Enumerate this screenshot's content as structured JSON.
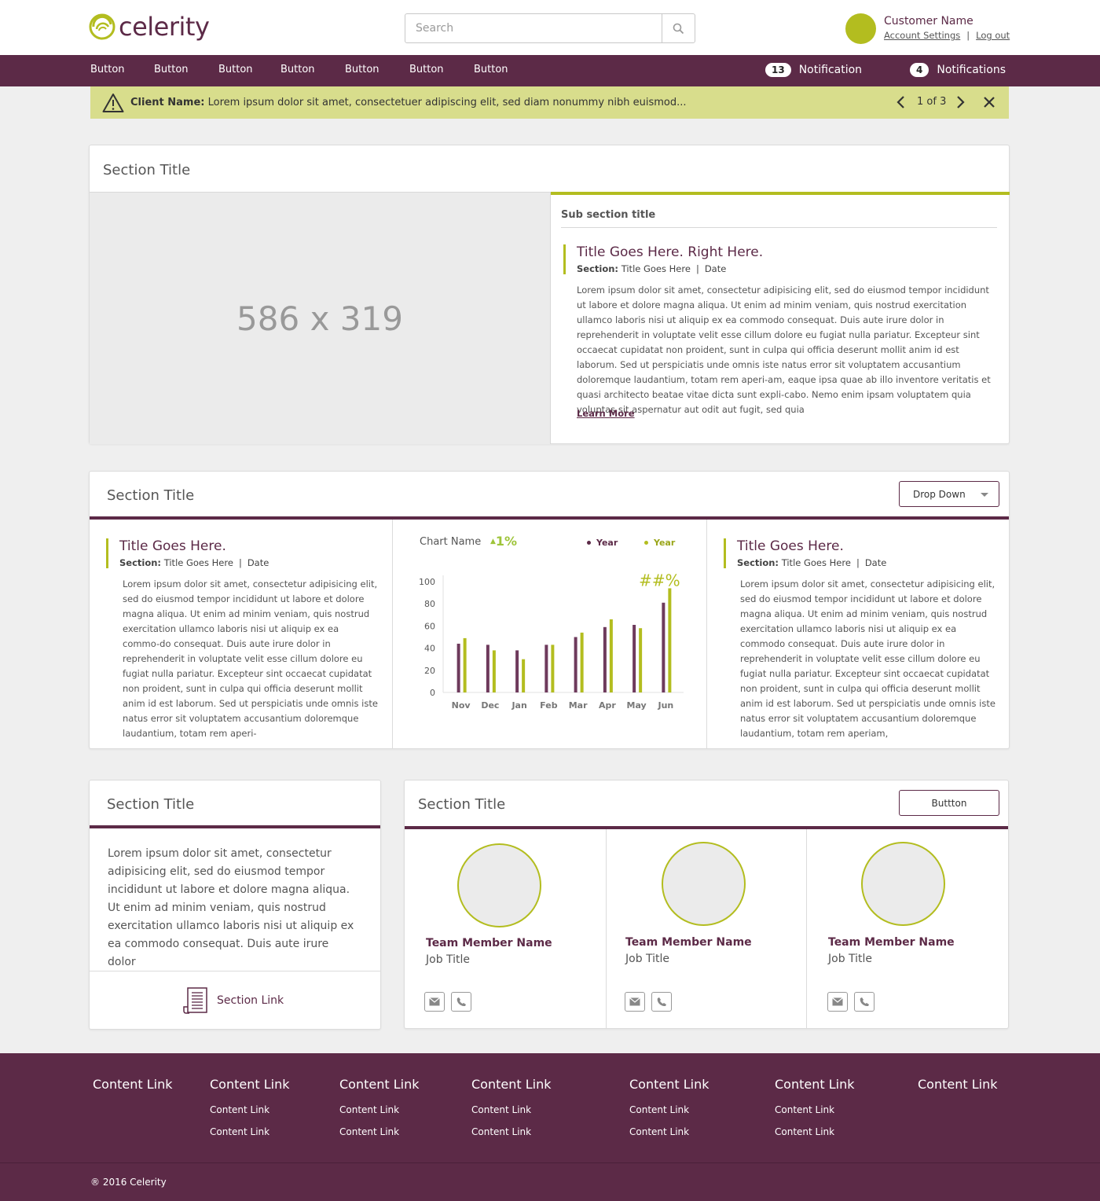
{
  "brand": {
    "name": "celerity",
    "accent": "#b3bd1f",
    "primary": "#5c2a47"
  },
  "header": {
    "search_placeholder": "Search",
    "user_name": "Customer Name",
    "account_settings": "Account Settings",
    "separator": "|",
    "logout": "Log out"
  },
  "nav": {
    "buttons": [
      "Button",
      "Button",
      "Button",
      "Button",
      "Button",
      "Button",
      "Button"
    ],
    "notifications": [
      {
        "count": "13",
        "label": "Notification"
      },
      {
        "count": "4",
        "label": "Notifications"
      }
    ]
  },
  "alert": {
    "label": "Client Name:",
    "message": "Lorem ipsum dolor sit amet, consectetuer adipiscing elit, sed diam nonummy nibh euismod...",
    "pager": "1 of 3"
  },
  "section1": {
    "title": "Section Title",
    "placeholder": "586 x 319",
    "sub_title": "Sub section title",
    "article": {
      "title": "Title Goes Here. Right Here.",
      "section_label": "Section:",
      "section_value": "Title Goes Here",
      "sep": "|",
      "date": "Date",
      "body": "Lorem ipsum dolor sit amet, consectetur adipisicing elit, sed do eiusmod tempor incididunt ut labore et dolore magna aliqua. Ut enim ad minim veniam, quis nostrud exercitation ullamco laboris nisi ut aliquip ex ea commodo consequat. Duis aute irure dolor in reprehenderit in voluptate velit esse cillum dolore eu fugiat nulla pariatur. Excepteur sint occaecat cupidatat non proident, sunt in culpa qui officia deserunt mollit anim id est laborum. Sed ut perspiciatis unde omnis iste natus error sit voluptatem accusantium doloremque laudantium, totam rem aperi-am, eaque ipsa quae ab illo inventore veritatis et quasi architecto beatae vitae dicta sunt expli-cabo. Nemo enim ipsam voluptatem quia voluptas sit aspernatur aut odit aut fugit, sed quia",
      "learn_more": "Learn More"
    }
  },
  "section2": {
    "title": "Section Title",
    "dropdown": "Drop Down",
    "left": {
      "title": "Title Goes Here.",
      "section_label": "Section:",
      "section_value": "Title Goes Here",
      "sep": "|",
      "date": "Date",
      "body": "Lorem ipsum dolor sit amet, consectetur adipisicing elit, sed do eiusmod tempor incididunt ut labore et dolore magna aliqua. Ut enim ad minim veniam, quis nostrud exercitation ullamco laboris nisi ut aliquip ex ea commo-do consequat. Duis aute irure dolor in reprehenderit in voluptate velit esse cillum dolore eu fugiat nulla pariatur. Excepteur sint occaecat cupidatat non proident, sunt in culpa qui officia deserunt mollit anim id est laborum. Sed ut perspiciatis unde omnis iste natus error sit voluptatem accusantium doloremque laudantium, totam rem aperi-"
    },
    "right": {
      "title": "Title Goes Here.",
      "section_label": "Section:",
      "section_value": "Title Goes Here",
      "sep": "|",
      "date": "Date",
      "body": "Lorem ipsum dolor sit amet, consectetur adipisicing elit, sed do eiusmod tempor incididunt ut labore et dolore magna aliqua. Ut enim ad minim veniam, quis nostrud exercitation ullamco laboris nisi ut aliquip ex ea commodo consequat. Duis aute irure dolor in reprehenderit in voluptate velit esse cillum dolore eu fugiat nulla pariatur. Excepteur sint occaecat cupidatat non proident, sunt in culpa qui officia deserunt mollit anim id est laborum. Sed ut perspiciatis unde omnis iste natus error sit voluptatem accusantium doloremque laudantium, totam rem aperiam,"
    }
  },
  "chart_data": {
    "type": "bar",
    "title": "Chart Name",
    "delta": "1%",
    "highlight_label": "##%",
    "categories": [
      "Nov",
      "Dec",
      "Jan",
      "Feb",
      "Mar",
      "Apr",
      "May",
      "Jun"
    ],
    "series": [
      {
        "name": "Year",
        "color": "#6e3a5c",
        "values": [
          44,
          43,
          38,
          43,
          50,
          59,
          61,
          81
        ]
      },
      {
        "name": "Year",
        "color": "#b3bd1f",
        "values": [
          49,
          38,
          30,
          43,
          54,
          66,
          58,
          94
        ]
      }
    ],
    "yticks": [
      0,
      20,
      40,
      60,
      80,
      100
    ],
    "ylim": [
      0,
      100
    ],
    "xlabel": "",
    "ylabel": "",
    "grid": false,
    "legend": "top-right"
  },
  "section3": {
    "title": "Section Title",
    "body": "Lorem ipsum dolor sit amet, consectetur adipisicing elit, sed do eiusmod tempor incididunt ut labore et dolore magna aliqua. Ut enim ad minim veniam, quis nostrud exercitation ullamco laboris nisi ut aliquip ex ea commodo consequat. Duis aute irure dolor",
    "link": "Section Link"
  },
  "section4": {
    "title": "Section Title",
    "button": "Buttton",
    "members": [
      {
        "name": "Team Member Name",
        "job": "Job Title"
      },
      {
        "name": "Team Member Name",
        "job": "Job Title"
      },
      {
        "name": "Team Member Name",
        "job": "Job Title"
      }
    ]
  },
  "footer": {
    "columns": [
      {
        "head": "Content Link",
        "links": []
      },
      {
        "head": "Content Link",
        "links": [
          "Content Link",
          "Content Link"
        ]
      },
      {
        "head": "Content Link",
        "links": [
          "Content Link",
          "Content Link"
        ]
      },
      {
        "head": "Content Link",
        "links": [
          "Content Link",
          "Content Link"
        ]
      },
      {
        "head": "Content Link",
        "links": [
          "Content Link",
          "Content Link"
        ]
      },
      {
        "head": "Content Link",
        "links": [
          "Content Link",
          "Content Link"
        ]
      },
      {
        "head": "Content Link",
        "links": []
      }
    ],
    "copyright": "® 2016 Celerity"
  }
}
